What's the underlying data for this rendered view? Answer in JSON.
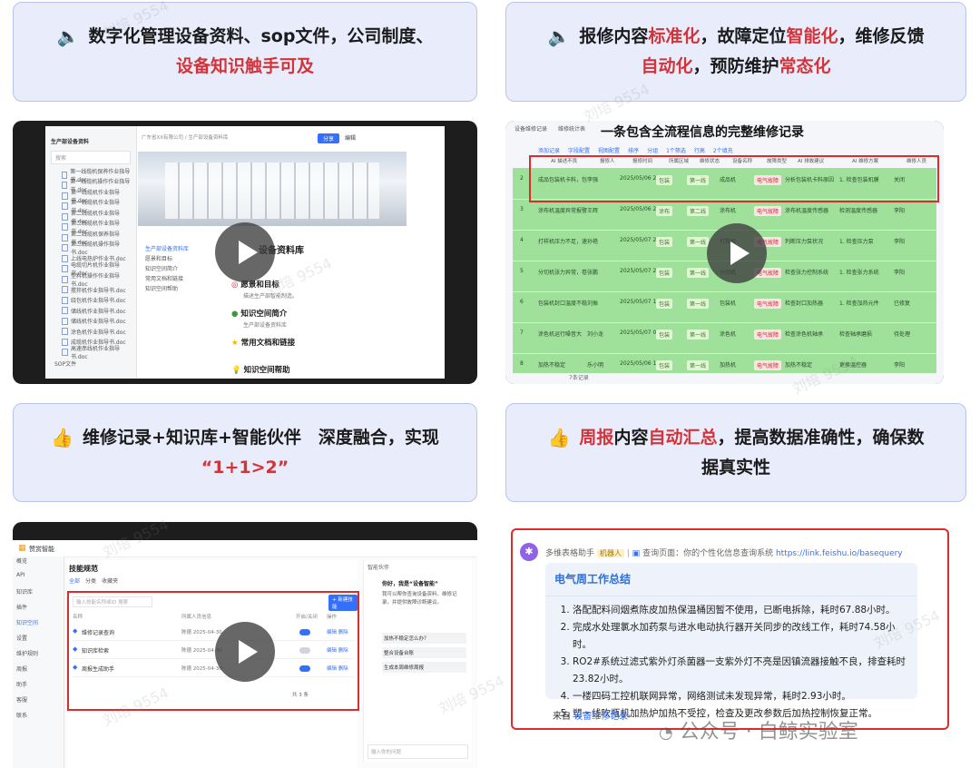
{
  "cards": {
    "top_left": {
      "line1": "数字化管理设备资料、sop文件，公司制度、",
      "line2_hl": "设备知识触手可及",
      "icon": "speaker-icon"
    },
    "top_right": {
      "a": "报修内容",
      "b": "标准化",
      "c": "，故障定位",
      "d": "智能化",
      "e": "，维修反馈",
      "f": "自动化",
      "g": "，预防维护",
      "h": "常态化",
      "icon": "speaker-icon"
    },
    "mid_left": {
      "line1": "维修记录+知识库+智能伙伴　深度融合，实现",
      "line2": "“1+1>2”",
      "icon": "thumbs-up-icon"
    },
    "mid_right": {
      "a": "周报",
      "b": "内容",
      "c": "自动汇总",
      "d": "，提高数据准确性，确保数",
      "e": "据真实性",
      "icon": "thumbs-up-icon"
    }
  },
  "screen1": {
    "space_title": "生产部设备资料",
    "search": "搜索",
    "breadcrumb": "广东省XX有限公司 / 生产部设备资料库",
    "share": "分享",
    "edit": "编辑",
    "files": [
      "第一线缆机保养作业指导书.doc",
      "第一线缆机操作作业指导书.doc",
      "第一线缆机作业指导书.doc",
      "第一线缆机作业指导书.doc",
      "第二线缆机作业指导书.doc",
      "第二线缆机作业指导书.doc",
      "第二线缆机保养指导书.doc",
      "第二线缆机操作指导书.doc",
      "上线电热炉作业书.doc",
      "电缆切片机作业指导书.doc",
      "塑料机操作作业指导书.doc",
      "搅拌机作业指导书.doc",
      "绕包机作业指导书.doc",
      "储线机作业指导书.doc",
      "储线机作业指导书.doc",
      "涂色机作业指导书.doc",
      "成缆机作业指导书.doc",
      "高速串线机作业指导书.doc"
    ],
    "folder": "SOP文件",
    "doc_title": "设备资料库",
    "toc": [
      "生产部设备资料库",
      "愿景和目标",
      "知识空间简介",
      "常用文档和链接",
      "知识空间帮助"
    ],
    "sec1": "愿景和目标",
    "sec1_sub": "描述生产部智能制造。",
    "sec2": "知识空间简介",
    "sec2_sub": "生产部设备资料库",
    "sec3": "常用文档和链接",
    "sec4": "知识空间帮助"
  },
  "screen2": {
    "title": "一条包含全流程信息的完整维修记录",
    "tabs": [
      "设备维修记录",
      "维修统计表"
    ],
    "toolbar": [
      "添加记录",
      "字段配置",
      "视图配置",
      "排序",
      "分组",
      "1个筛选",
      "行高",
      "2个填充"
    ],
    "headers": [
      "AI 描述不良",
      "报修人",
      "报修时间",
      "所属区域",
      "维修状态",
      "设备名称",
      "故障类型",
      "AI 排故建议",
      "AI 维修方案",
      "维修人员"
    ],
    "rows": [
      [
        "2",
        "成品包装机卡料，包装膜跑偏",
        "李强",
        "2025/05/06 22:45",
        "包装",
        "第一线",
        "成品机",
        "电气故障",
        "分析包装机卡料原因",
        "1. 检查包装机膜",
        "关闭"
      ],
      [
        "3",
        "涂布机温度异常报警",
        "王辉",
        "2025/05/06 23:10",
        "涂布",
        "第二线",
        "涂布机",
        "电气故障",
        "涂布机温度传感器",
        "检测温度传感器",
        "李阳"
      ],
      [
        "4",
        "打样机压力不足，速度慢",
        "孙艳",
        "2025/05/07 20:51",
        "包装",
        "第一线",
        "打样机",
        "电气故障",
        "判断压力泵状况",
        "1. 检查压力泵",
        "李阳"
      ],
      [
        "5",
        "分切机张力异常，卷料起皱",
        "张鹏",
        "2025/05/07 20:19",
        "包装",
        "第一线",
        "分切机",
        "电气故障",
        "检查张力控制系统",
        "1. 检查张力系统",
        "李阳"
      ],
      [
        "6",
        "包装机封口温度不稳定",
        "刘振",
        "2025/05/07 15:04",
        "包装",
        "第一线",
        "包装机",
        "电气故障",
        "检查封口加热器",
        "1. 检查加热元件",
        "已修复"
      ],
      [
        "7",
        "涂色机运行噪音大",
        "刘小龙",
        "2025/05/07 03:01",
        "包装",
        "第一线",
        "涂色机",
        "电气故障",
        "检查涂色机轴承",
        "检查轴承磨损",
        "待处理"
      ],
      [
        "8",
        "加热不稳定",
        "乐小明",
        "2025/05/06 10:00",
        "包装",
        "第一线",
        "加热机",
        "电气故障",
        "加热不稳定",
        "更换温控器",
        "李阳"
      ]
    ],
    "footer": "7条记录"
  },
  "screen3": {
    "app_name": "赞赏智能",
    "page_title": "技能规范",
    "tabs": [
      "全部",
      "分类",
      "收藏夹"
    ],
    "search_placeholder": "输入技能名称或ID 搜索",
    "new_button": "+ 新建技能",
    "col_headers": [
      "名称",
      "所属人员信息",
      "开启/关闭",
      "操作"
    ],
    "nav": [
      "概览",
      "API",
      "知识库",
      "插件",
      "知识空间",
      "设置",
      "维护规则",
      "周报",
      "助手",
      "客服",
      "联系"
    ],
    "rows": [
      {
        "name": "维修记录查询",
        "info": "陈德 2025-04-30",
        "on": true,
        "ops": "编辑 删除"
      },
      {
        "name": "知识库检索",
        "info": "陈德 2025-04-30",
        "on": false,
        "ops": "编辑 删除"
      },
      {
        "name": "周报生成助手",
        "info": "陈德 2025-04-30",
        "on": true,
        "ops": "编辑 删除"
      }
    ],
    "pagination": "共 3 条",
    "chat_title": "智能伙伴",
    "chat_greeting": "你好，我是“设备智能”",
    "chat_body": "我可以帮你查询设备资料、维修记录，并提供故障诊断建议。",
    "chat_q1": "加热不稳定怎么办？",
    "chat_q2": "整合设备台账",
    "chat_q3": "生成本周维修周报",
    "chat_input_placeholder": "输入你的问题"
  },
  "report": {
    "bot_name": "多维表格助手",
    "bot_tag": "机器人",
    "query_prefix": "查询页面：你的个性化信息查询系统",
    "link": "https://link.feishu.io/basequery",
    "title": "电气周工作总结",
    "items": [
      "洛配配料间烟煮陈皮加热保温桶因暂不使用，已断电拆除，耗时67.88小时。",
      "完成水处理氯水加药泵与进水电动执行器开关同步的改线工作，耗时74.58小时。",
      "RO2#系统过滤式紫外灯杀菌器一支紫外灯不亮是因镇流器接触不良，排查耗时23.82小时。",
      "一楼四码工控机联网异常，网络测试未发现异常，耗时2.93小时。",
      "塑一线吹瓶机加热炉加热不受控，检查及更改参数后加热控制恢复正常。"
    ],
    "from_label": "来自",
    "from_link": "设备维修记录"
  },
  "watermark": {
    "text": "刘培 9554",
    "brand": "公众号 · 白鲸实验室"
  },
  "colors": {
    "card_bg": "#e8ecfb",
    "card_border": "#b9c4ee",
    "highlight": "#d2343a",
    "red_box": "#e02b2b",
    "table_green": "#9fe09b"
  }
}
